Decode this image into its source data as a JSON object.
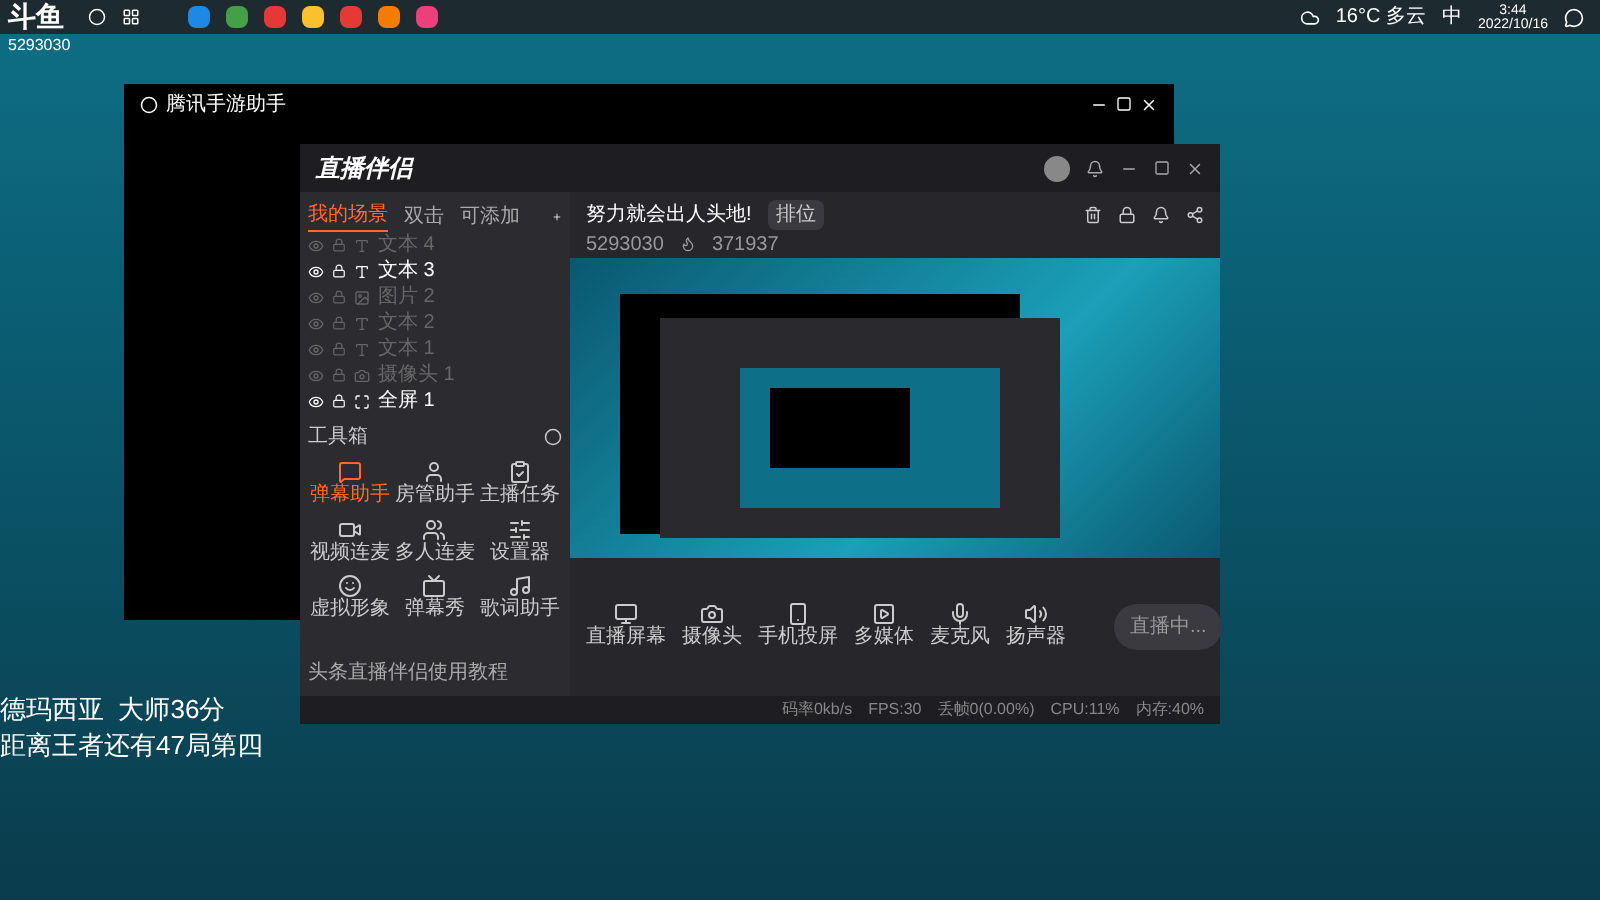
{
  "desktop_overlay": {
    "logo": "斗鱼",
    "room": "5293030",
    "lines": [
      "德玛西亚  大师36分",
      "距离王者还有47局第四"
    ]
  },
  "taskbar": {
    "weather": "16°C 多云",
    "ime": "中",
    "time": "3:44",
    "date": "2022/10/16"
  },
  "back_window": {
    "title": "腾讯手游助手"
  },
  "app": {
    "logo": "直播伴侣",
    "scene_tabs": [
      {
        "label": "我的场景",
        "selected": true
      },
      {
        "label": "双击",
        "selected": false
      },
      {
        "label": "可添加",
        "selected": false
      }
    ],
    "sources": [
      {
        "label": "文本 4",
        "visible": false
      },
      {
        "label": "文本 3",
        "visible": true
      },
      {
        "label": "图片 2",
        "visible": false
      },
      {
        "label": "文本 2",
        "visible": false
      },
      {
        "label": "文本 1",
        "visible": false
      },
      {
        "label": "摄像头 1",
        "visible": false
      },
      {
        "label": "全屏 1",
        "visible": true
      }
    ],
    "toolbox_title": "工具箱",
    "tools": [
      {
        "label": "弹幕助手",
        "selected": true
      },
      {
        "label": "房管助手",
        "selected": false
      },
      {
        "label": "主播任务",
        "selected": false
      },
      {
        "label": "视频连麦",
        "selected": false
      },
      {
        "label": "多人连麦",
        "selected": false
      },
      {
        "label": "设置器",
        "selected": false
      },
      {
        "label": "虚拟形象",
        "selected": false
      },
      {
        "label": "弹幕秀",
        "selected": false
      },
      {
        "label": "歌词助手",
        "selected": false
      }
    ],
    "notice": "头条直播伴侣使用教程",
    "stream_title": "努力就会出人头地!",
    "category": "排位",
    "room_id": "5293030",
    "popularity": "371937",
    "controls": [
      "直播屏幕",
      "摄像头",
      "手机投屏",
      "多媒体",
      "麦克风",
      "扬声器"
    ],
    "start_button": "直播中...",
    "stats": [
      "码率0kb/s",
      "FPS:30",
      "丢帧0(0.00%)",
      "CPU:11%",
      "内存:40%"
    ]
  }
}
